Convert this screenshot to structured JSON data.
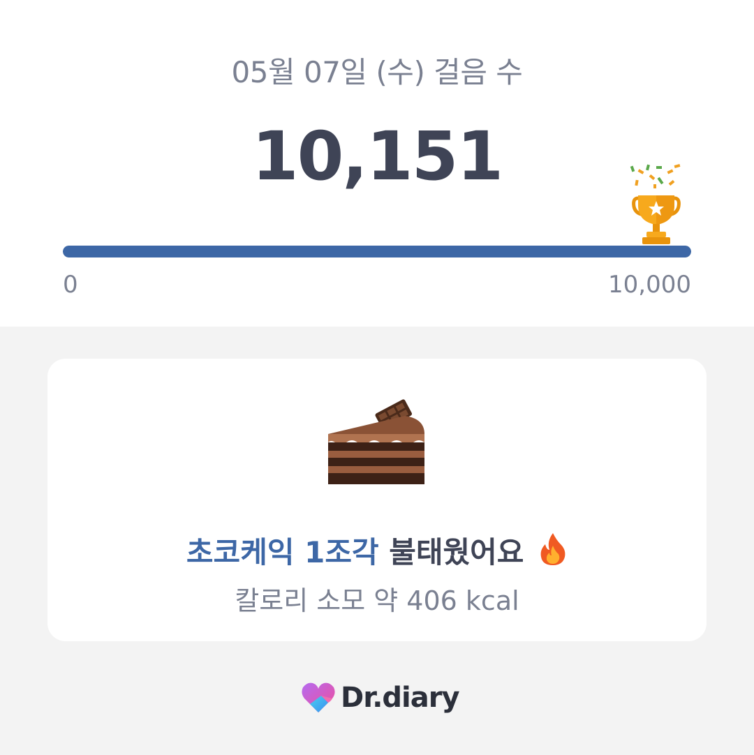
{
  "header": {
    "date_title": "05월 07일 (수) 걸음 수",
    "step_count": "10,151"
  },
  "progress": {
    "min_label": "0",
    "max_label": "10,000",
    "fraction": 1.0,
    "fill_color": "#3d67a6",
    "trophy_icon": "trophy-icon"
  },
  "calorie_card": {
    "food_icon": "chocolate-cake-icon",
    "headline_accent": "초코케익 1조각",
    "headline_rest": "불태웠어요",
    "headline_emoji_icon": "fire-icon",
    "subline": "칼로리 소모 약 406 kcal"
  },
  "footer": {
    "brand_icon": "heart-logo-icon",
    "brand_name": "Dr.diary"
  },
  "colors": {
    "accent": "#3d67a6",
    "title_text": "#3f4456",
    "muted_text": "#7a8091",
    "background": "#f3f3f3"
  }
}
